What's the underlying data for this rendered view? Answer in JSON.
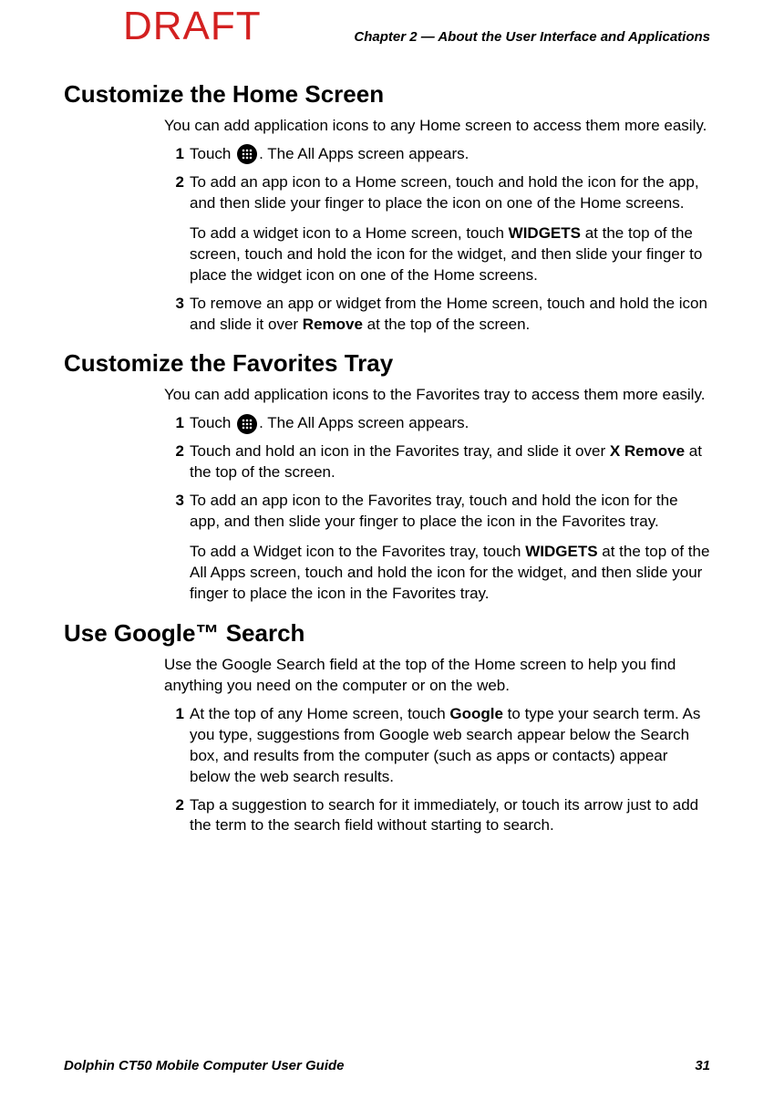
{
  "watermark": "DRAFT",
  "header": {
    "chapter": "Chapter 2 — About the User Interface and Applications"
  },
  "sections": [
    {
      "heading": "Customize the Home Screen",
      "intro": "You can add application icons to any Home screen to access them more easily.",
      "steps": [
        {
          "num": "1",
          "pre": "Touch ",
          "icon": "all-apps-icon",
          "post": ". The All Apps screen appears."
        },
        {
          "num": "2",
          "text_parts": [
            "To add an app icon to a Home screen, touch and hold the icon for the app, and then slide your finger to place the icon on one of the Home screens."
          ],
          "subpara_parts": [
            {
              "t": "To add a widget icon to a Home screen, touch "
            },
            {
              "t": "WIDGETS",
              "b": true
            },
            {
              "t": " at the top of the screen, touch and hold the icon for the widget, and then slide your finger to place the widget icon on one of the Home screens."
            }
          ]
        },
        {
          "num": "3",
          "text_parts": [
            {
              "t": "To remove an app or widget from the Home screen, touch and hold the icon and slide it over "
            },
            {
              "t": "Remove",
              "b": true
            },
            {
              "t": " at the top of the screen."
            }
          ]
        }
      ]
    },
    {
      "heading": "Customize the Favorites Tray",
      "intro": "You can add application icons to the Favorites tray to access them more easily.",
      "steps": [
        {
          "num": "1",
          "pre": "Touch ",
          "icon": "all-apps-icon",
          "post": ". The All Apps screen appears."
        },
        {
          "num": "2",
          "text_parts": [
            {
              "t": "Touch and hold an icon in the Favorites tray, and slide it over "
            },
            {
              "t": "X Remove",
              "b": true
            },
            {
              "t": " at the top of the screen."
            }
          ]
        },
        {
          "num": "3",
          "text_parts": [
            {
              "t": "To add an app icon to the Favorites tray, touch and hold the icon for the app, and then slide your finger to place the icon in the Favorites tray."
            }
          ],
          "subpara_parts": [
            {
              "t": "To add a Widget icon to the Favorites tray, touch "
            },
            {
              "t": "WIDGETS",
              "b": true
            },
            {
              "t": " at the top of the All Apps screen, touch and hold the icon for the widget, and then slide your finger to place the icon in the Favorites tray."
            }
          ]
        }
      ]
    },
    {
      "heading": "Use Google™ Search",
      "intro": "Use the Google Search field at the top of the Home screen to help you find anything you need on the computer or on the web.",
      "steps": [
        {
          "num": "1",
          "text_parts": [
            {
              "t": "At the top of any Home screen, touch "
            },
            {
              "t": "Google",
              "b": true
            },
            {
              "t": " to type your search term. As you type, suggestions from Google web search appear below the Search box, and results from the computer (such as apps or contacts) appear below the web search results."
            }
          ]
        },
        {
          "num": "2",
          "text_parts": [
            {
              "t": "Tap a suggestion to search for it immediately, or touch its arrow just to add the term to the search field without starting to search."
            }
          ]
        }
      ]
    }
  ],
  "footer": {
    "guide": "Dolphin CT50 Mobile Computer User Guide",
    "page": "31"
  }
}
